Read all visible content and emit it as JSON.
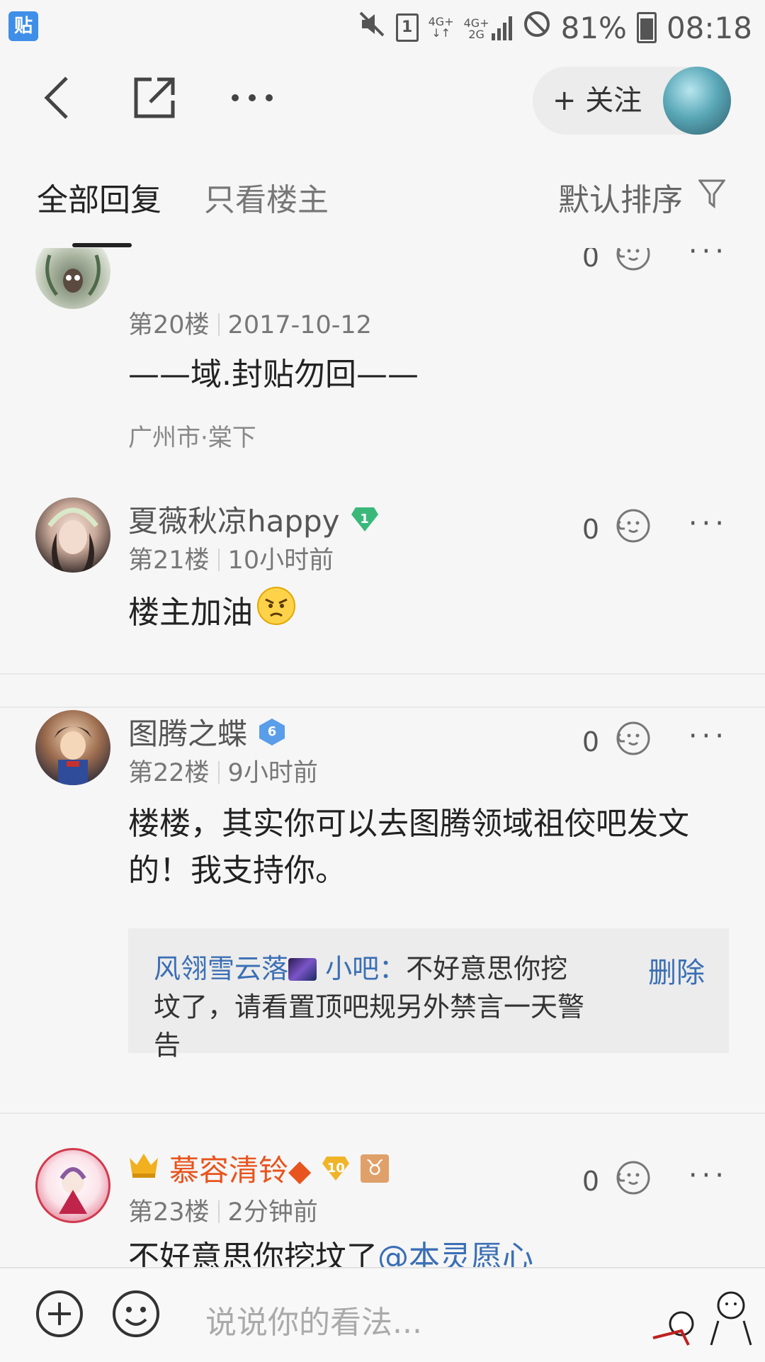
{
  "status_bar": {
    "app_icon_char": "贴",
    "network_top": "4G+",
    "network_bottom": "2G",
    "sim_slot": "1",
    "battery": "81%",
    "time": "08:18"
  },
  "navbar": {
    "follow_label": "+ 关注"
  },
  "tabs": {
    "all_replies": "全部回复",
    "op_only": "只看楼主",
    "sort": "默认排序"
  },
  "posts": [
    {
      "floor": "第20楼",
      "date": "2017-10-12",
      "likes": "0",
      "content": "——域.封贴勿回——",
      "location": "广州市·棠下"
    },
    {
      "username": "夏薇秋凉happy",
      "level": "1",
      "floor": "第21楼",
      "date": "10小时前",
      "likes": "0",
      "content": "楼主加油"
    },
    {
      "username": "图腾之蝶",
      "level": "6",
      "floor": "第22楼",
      "date": "9小时前",
      "likes": "0",
      "content": "楼楼，其实你可以去图腾领域祖佼吧发文的！我支持你。",
      "reply": {
        "author": "风翎雪云落",
        "author_suffix": "小吧：",
        "text": "不好意思你挖坟了，请看置顶吧规另外禁言一天警告",
        "delete_label": "删除"
      }
    },
    {
      "username": "慕容清铃◆",
      "level": "10",
      "zodiac": "♉",
      "floor": "第23楼",
      "date": "2分钟前",
      "likes": "0",
      "content": "不好意思你挖坟了",
      "mention": "@本灵愿心"
    }
  ],
  "bottom": {
    "input_placeholder": "说说你的看法..."
  },
  "colors": {
    "accent_blue": "#3b6fb5",
    "vip_orange": "#e8541e",
    "level_green": "#3ab87a",
    "level_blue": "#5a9de8",
    "level_gold": "#f0b429"
  }
}
